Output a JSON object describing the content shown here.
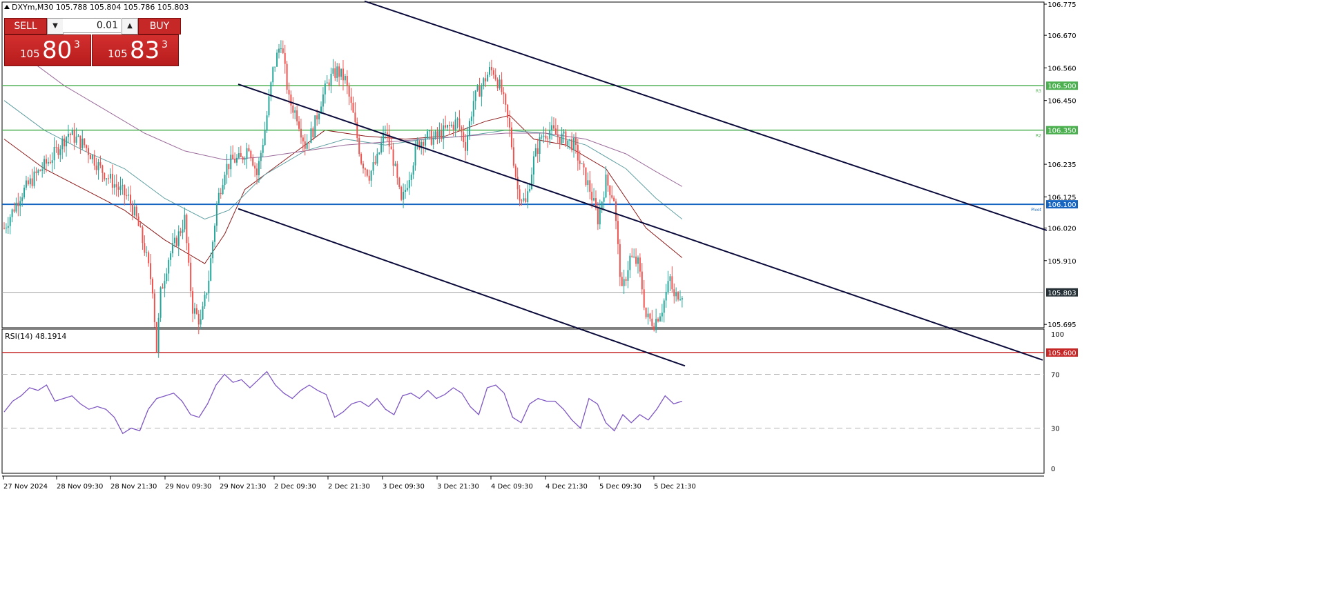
{
  "header": {
    "symbol_line": "DXYm,M30  105.788 105.804 105.786 105.803"
  },
  "trade_panel": {
    "sell_label": "SELL",
    "buy_label": "BUY",
    "lot_value": "0.01",
    "bid_small": "105",
    "bid_big": "80",
    "bid_sup": "3",
    "ask_small": "105",
    "ask_big": "83",
    "ask_sup": "3",
    "up_glyph": "▲",
    "down_glyph": "▼"
  },
  "colors": {
    "bull": "#26a69a",
    "bear": "#ef5350",
    "level_green": "#4caf50",
    "level_blue": "#1565c0",
    "level_red": "#c62828",
    "channel": "#0b0b3b",
    "rsi": "#7e57c2",
    "ma1": "#8b1a1a",
    "ma2": "#5f9ea0",
    "ma3": "#9a6b9a"
  },
  "chart_data": [
    {
      "type": "candlestick",
      "ylim": [
        105.55,
        106.8
      ],
      "grid": false,
      "y_ticks": [
        106.775,
        106.67,
        106.56,
        106.45,
        106.235,
        106.125,
        106.02,
        105.91,
        105.695
      ],
      "x_ticks": [
        "27 Nov 2024",
        "28 Nov 09:30",
        "28 Nov 21:30",
        "29 Nov 09:30",
        "29 Nov 21:30",
        "2 Dec 09:30",
        "2 Dec 21:30",
        "3 Dec 09:30",
        "3 Dec 21:30",
        "4 Dec 09:30",
        "4 Dec 21:30",
        "5 Dec 09:30",
        "5 Dec 21:30"
      ],
      "levels": [
        {
          "value": 106.5,
          "label": "106.500",
          "tag": "R3",
          "color": "#4caf50"
        },
        {
          "value": 106.35,
          "label": "106.350",
          "tag": "R2",
          "color": "#4caf50"
        },
        {
          "value": 106.1,
          "label": "106.100",
          "tag": "Pivot",
          "color": "#1565c0"
        },
        {
          "value": 105.6,
          "label": "105.600",
          "tag": "",
          "color": "#c62828"
        }
      ],
      "current_price": {
        "value": 105.803,
        "label": "105.803"
      },
      "channel_lines": [
        {
          "x": [
            "3 Dec 09:30",
            "extends right"
          ],
          "y": [
            106.785,
            106.012
          ]
        },
        {
          "x": [
            "2 Dec 09:30",
            "extends right"
          ],
          "y": [
            106.505,
            105.575
          ]
        },
        {
          "x": [
            "29 Nov 21:30",
            "5 Dec 21:30"
          ],
          "y": [
            106.085,
            105.555
          ]
        }
      ],
      "close_path": [
        [
          0,
          106.02
        ],
        [
          8,
          106.13
        ],
        [
          16,
          106.2
        ],
        [
          24,
          106.26
        ],
        [
          32,
          106.34
        ],
        [
          40,
          106.3
        ],
        [
          48,
          106.22
        ],
        [
          56,
          106.16
        ],
        [
          62,
          106.12
        ],
        [
          66,
          106.05
        ],
        [
          70,
          105.95
        ],
        [
          74,
          105.82
        ],
        [
          76,
          105.61
        ],
        [
          78,
          105.8
        ],
        [
          82,
          105.92
        ],
        [
          86,
          105.98
        ],
        [
          90,
          106.05
        ],
        [
          92,
          105.88
        ],
        [
          94,
          105.75
        ],
        [
          98,
          105.7
        ],
        [
          102,
          105.85
        ],
        [
          106,
          106.1
        ],
        [
          110,
          106.22
        ],
        [
          114,
          106.25
        ],
        [
          118,
          106.25
        ],
        [
          122,
          106.3
        ],
        [
          126,
          106.2
        ],
        [
          130,
          106.35
        ],
        [
          134,
          106.55
        ],
        [
          138,
          106.65
        ],
        [
          142,
          106.45
        ],
        [
          146,
          106.4
        ],
        [
          150,
          106.3
        ],
        [
          154,
          106.35
        ],
        [
          158,
          106.45
        ],
        [
          162,
          106.52
        ],
        [
          166,
          106.55
        ],
        [
          170,
          106.52
        ],
        [
          174,
          106.4
        ],
        [
          178,
          106.25
        ],
        [
          182,
          106.2
        ],
        [
          186,
          106.25
        ],
        [
          190,
          106.35
        ],
        [
          194,
          106.25
        ],
        [
          198,
          106.1
        ],
        [
          202,
          106.2
        ],
        [
          206,
          106.3
        ],
        [
          210,
          106.33
        ],
        [
          214,
          106.32
        ],
        [
          218,
          106.34
        ],
        [
          222,
          106.36
        ],
        [
          226,
          106.38
        ],
        [
          230,
          106.3
        ],
        [
          234,
          106.45
        ],
        [
          238,
          106.5
        ],
        [
          242,
          106.55
        ],
        [
          244,
          106.55
        ],
        [
          248,
          106.48
        ],
        [
          252,
          106.35
        ],
        [
          256,
          106.15
        ],
        [
          260,
          106.1
        ],
        [
          264,
          106.25
        ],
        [
          268,
          106.33
        ],
        [
          272,
          106.35
        ],
        [
          276,
          106.33
        ],
        [
          280,
          106.32
        ],
        [
          284,
          106.3
        ],
        [
          288,
          106.22
        ],
        [
          292,
          106.15
        ],
        [
          296,
          106.05
        ],
        [
          300,
          106.18
        ],
        [
          304,
          106.12
        ],
        [
          306,
          105.95
        ],
        [
          308,
          105.8
        ],
        [
          312,
          105.92
        ],
        [
          316,
          105.9
        ],
        [
          318,
          105.82
        ],
        [
          320,
          105.72
        ],
        [
          324,
          105.7
        ],
        [
          328,
          105.75
        ],
        [
          332,
          105.85
        ],
        [
          334,
          105.78
        ],
        [
          336,
          105.8
        ],
        [
          338,
          105.803
        ]
      ],
      "moving_averages": [
        {
          "color": "#8b1a1a",
          "points": [
            [
              0,
              106.32
            ],
            [
              20,
              106.22
            ],
            [
              40,
              106.15
            ],
            [
              60,
              106.08
            ],
            [
              80,
              105.98
            ],
            [
              100,
              105.9
            ],
            [
              110,
              106.0
            ],
            [
              120,
              106.15
            ],
            [
              140,
              106.25
            ],
            [
              160,
              106.35
            ],
            [
              180,
              106.33
            ],
            [
              200,
              106.32
            ],
            [
              220,
              106.33
            ],
            [
              240,
              106.38
            ],
            [
              252,
              106.4
            ],
            [
              264,
              106.32
            ],
            [
              280,
              106.3
            ],
            [
              300,
              106.22
            ],
            [
              320,
              106.02
            ],
            [
              338,
              105.92
            ]
          ]
        },
        {
          "color": "#5f9ea0",
          "points": [
            [
              0,
              106.45
            ],
            [
              20,
              106.35
            ],
            [
              40,
              106.28
            ],
            [
              60,
              106.22
            ],
            [
              80,
              106.12
            ],
            [
              100,
              106.05
            ],
            [
              112,
              106.08
            ],
            [
              130,
              106.2
            ],
            [
              150,
              106.28
            ],
            [
              170,
              106.32
            ],
            [
              190,
              106.3
            ],
            [
              210,
              106.32
            ],
            [
              230,
              106.33
            ],
            [
              250,
              106.35
            ],
            [
              270,
              106.34
            ],
            [
              290,
              106.3
            ],
            [
              310,
              106.22
            ],
            [
              325,
              106.12
            ],
            [
              338,
              106.05
            ]
          ]
        },
        {
          "color": "#9a6b9a",
          "points": [
            [
              10,
              106.6
            ],
            [
              30,
              106.5
            ],
            [
              50,
              106.42
            ],
            [
              70,
              106.34
            ],
            [
              90,
              106.28
            ],
            [
              110,
              106.25
            ],
            [
              130,
              106.26
            ],
            [
              150,
              106.28
            ],
            [
              170,
              106.3
            ],
            [
              190,
              106.31
            ],
            [
              210,
              106.32
            ],
            [
              230,
              106.33
            ],
            [
              250,
              106.34
            ],
            [
              270,
              106.34
            ],
            [
              290,
              106.32
            ],
            [
              310,
              106.27
            ],
            [
              325,
              106.21
            ],
            [
              338,
              106.16
            ]
          ]
        }
      ]
    },
    {
      "type": "line",
      "title": "RSI(14) 48.1914",
      "ylim": [
        0,
        100
      ],
      "y_ticks": [
        100,
        70,
        30,
        0
      ],
      "levels": [
        70,
        30
      ],
      "series": [
        {
          "values": [
            42,
            50,
            54,
            60,
            58,
            62,
            50,
            52,
            54,
            48,
            44,
            46,
            44,
            38,
            26,
            30,
            28,
            44,
            52,
            54,
            56,
            50,
            40,
            38,
            48,
            62,
            70,
            64,
            66,
            60,
            66,
            72,
            62,
            56,
            52,
            58,
            62,
            58,
            55,
            38,
            42,
            48,
            50,
            46,
            52,
            44,
            40,
            54,
            56,
            52,
            58,
            52,
            55,
            60,
            56,
            46,
            40,
            60,
            62,
            56,
            38,
            34,
            48,
            52,
            50,
            50,
            44,
            36,
            30,
            52,
            48,
            34,
            28,
            40,
            34,
            40,
            36,
            44,
            54,
            48,
            50
          ]
        }
      ]
    }
  ]
}
